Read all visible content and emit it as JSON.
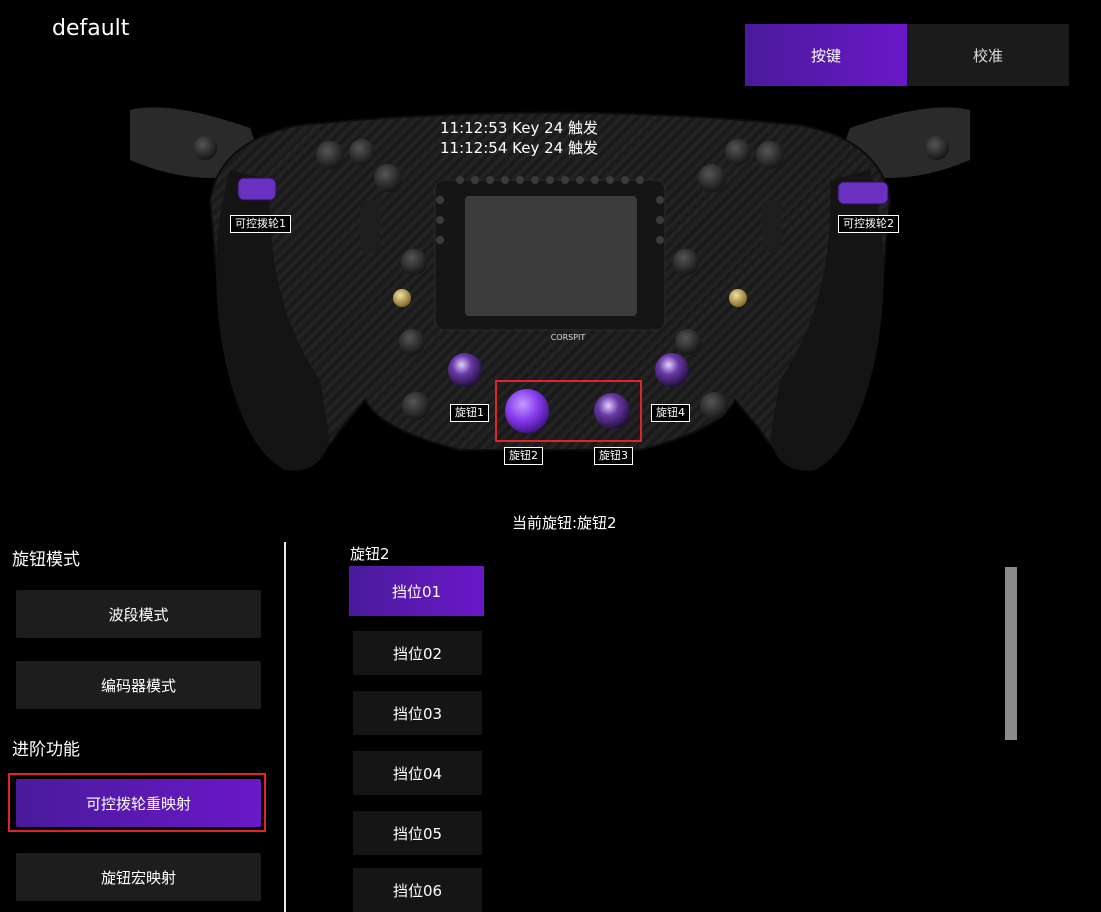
{
  "profile": {
    "name": "default"
  },
  "tabs": [
    {
      "label": "按键",
      "active": true
    },
    {
      "label": "校准",
      "active": false
    }
  ],
  "event_log": [
    "11:12:53  Key 24 触发",
    "11:12:54  Key 24 触发"
  ],
  "wheel": {
    "brand_logo": "CORSPIT",
    "labels": {
      "paddle1": "可控拨轮1",
      "paddle2": "可控拨轮2",
      "knob1": "旋钮1",
      "knob2": "旋钮2",
      "knob3": "旋钮3",
      "knob4": "旋钮4"
    }
  },
  "current_knob": "当前旋钮:旋钮2",
  "left_panel": {
    "knob_mode_title": "旋钮模式",
    "band_mode": "波段模式",
    "encoder_mode": "编码器模式",
    "advanced_title": "进阶功能",
    "paddle_remap": "可控拨轮重映射",
    "knob_macro": "旋钮宏映射"
  },
  "position_list": {
    "title": "旋钮2",
    "items": [
      "挡位01",
      "挡位02",
      "挡位03",
      "挡位04",
      "挡位05",
      "挡位06"
    ],
    "selected_index": 0
  },
  "colors": {
    "accent_start": "#4a1a9a",
    "accent_end": "#6a18c8",
    "highlight_frame": "#e0242a",
    "knob_glow": "#8a3cf0"
  }
}
